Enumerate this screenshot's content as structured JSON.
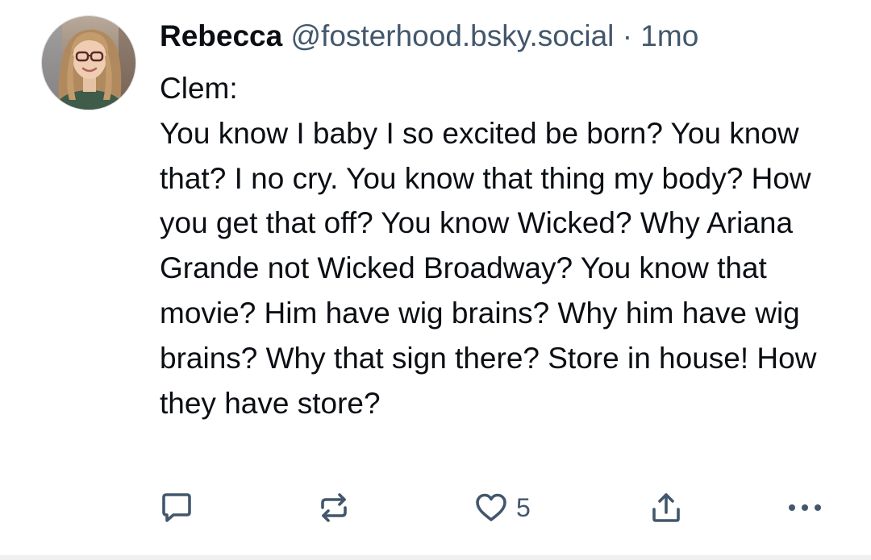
{
  "post": {
    "author": {
      "display_name": "Rebecca",
      "handle": "@fosterhood.bsky.social",
      "separator": "·",
      "timestamp": "1mo"
    },
    "text": {
      "line1": "Clem:",
      "line2": "You know I baby I so excited be born? You know that? I no cry. You know that thing my body? How you get that off? You know Wicked? Why Ariana Grande not Wicked Broadway? You know that movie? Him have wig brains? Why him have wig brains? Why that sign there? Store in house! How they have store?"
    },
    "actions": {
      "reply_icon": "speech-bubble-icon",
      "repost_icon": "repost-arrows-icon",
      "like_icon": "heart-icon",
      "like_count": "5",
      "share_icon": "share-upload-icon",
      "more_icon": "ellipsis-icon"
    }
  },
  "colors": {
    "text_primary": "#0b0f14",
    "text_secondary": "#42576c",
    "background": "#ffffff"
  }
}
